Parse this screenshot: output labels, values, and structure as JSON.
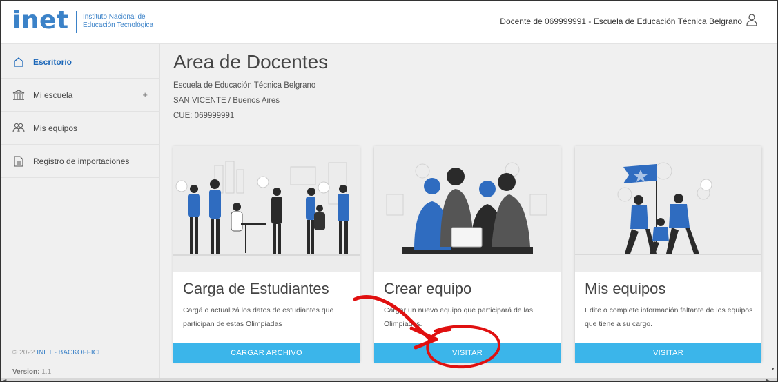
{
  "header": {
    "logo_word": "inet",
    "logo_line1": "Instituto Nacional de",
    "logo_line2": "Educación Tecnológica",
    "user_info": "Docente de 069999991 - Escuela de Educación Técnica Belgrano"
  },
  "sidebar": {
    "items": [
      {
        "label": "Escritorio",
        "icon": "home-icon",
        "active": true
      },
      {
        "label": "Mi escuela",
        "icon": "school-building-icon",
        "expand": "+"
      },
      {
        "label": "Mis equipos",
        "icon": "users-icon"
      },
      {
        "label": "Registro de importaciones",
        "icon": "document-icon"
      }
    ],
    "copyright_prefix": "© 2022",
    "copyright_brand": "INET - BACKOFFICE",
    "version_label": "Version:",
    "version_value": "1.1"
  },
  "main": {
    "title": "Area de Docentes",
    "school_name": "Escuela de Educación Técnica Belgrano",
    "location": "SAN VICENTE / Buenos Aires",
    "cue": "CUE: 069999991",
    "cards": [
      {
        "title": "Carga de Estudiantes",
        "description": "Cargá o actualizá los datos de estudiantes que participan de estas Olimpiadas",
        "button": "CARGAR ARCHIVO",
        "illustration": "students-office-illustration"
      },
      {
        "title": "Crear equipo",
        "description": "Cargar un nuevo equipo que participará de las Olimpiadas.",
        "button": "VISITAR",
        "illustration": "team-laptop-illustration"
      },
      {
        "title": "Mis equipos",
        "description": "Edite o complete información faltante de los equipos que tiene a su cargo.",
        "button": "VISITAR",
        "illustration": "team-flag-illustration"
      }
    ]
  },
  "colors": {
    "brand_blue": "#3b82c8",
    "button_blue": "#3bb5ea",
    "annotation_red": "#e01010"
  }
}
